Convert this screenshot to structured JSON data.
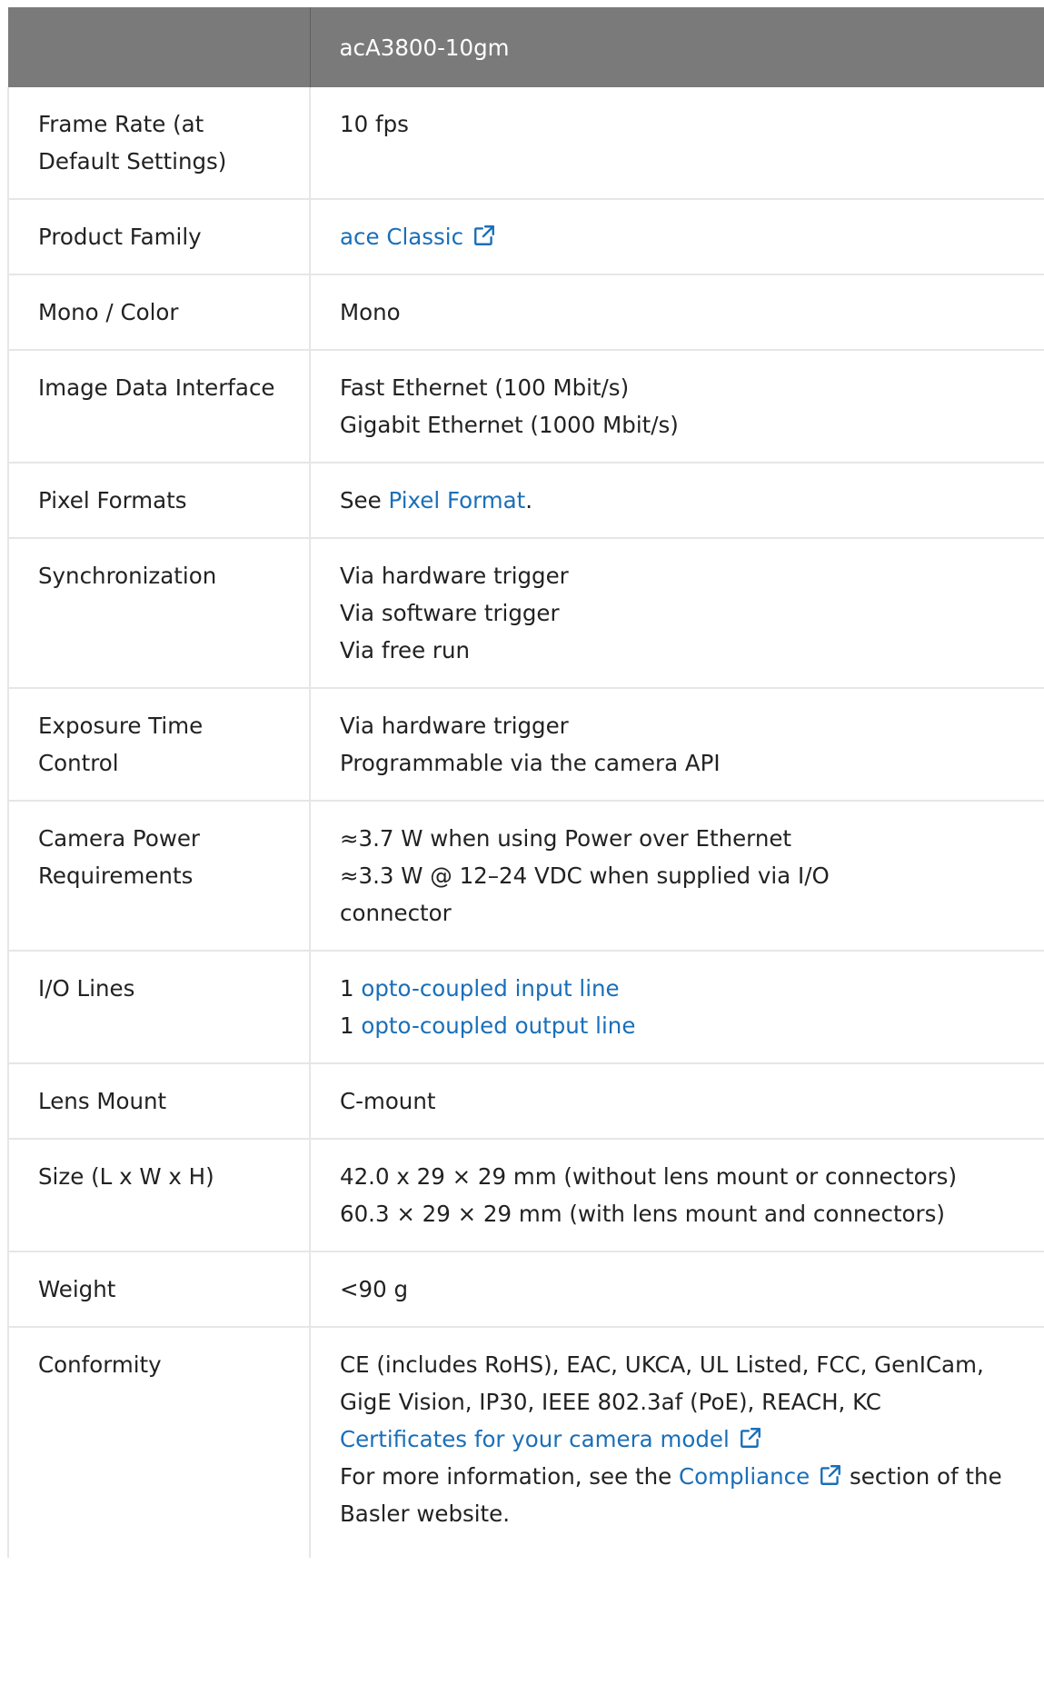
{
  "header": {
    "label_col": "",
    "model": "acA3800-10gm"
  },
  "rows": {
    "frame_rate": {
      "label": "Frame Rate (at Default Settings)",
      "value": "10 fps"
    },
    "product_family": {
      "label": "Product Family",
      "link": "ace Classic"
    },
    "mono_color": {
      "label": "Mono / Color",
      "value": "Mono"
    },
    "image_data_interface": {
      "label": "Image Data Interface",
      "lines": [
        "Fast Ethernet (100 Mbit/s)",
        "Gigabit Ethernet (1000 Mbit/s)"
      ]
    },
    "pixel_formats": {
      "label": "Pixel Formats",
      "prefix": "See ",
      "link": "Pixel Format",
      "suffix": "."
    },
    "synchronization": {
      "label": "Synchronization",
      "lines": [
        "Via hardware trigger",
        "Via software trigger",
        "Via free run"
      ]
    },
    "exposure_time_control": {
      "label": "Exposure Time Control",
      "lines": [
        "Via hardware trigger",
        "Programmable via the camera API"
      ]
    },
    "camera_power": {
      "label": "Camera Power Requirements",
      "lines": [
        "≈3.7 W when using Power over Ethernet",
        "≈3.3 W @ 12–24 VDC when supplied via I/O connector"
      ]
    },
    "io_lines": {
      "label": "I/O Lines",
      "input_prefix": "1 ",
      "input_link": "opto-coupled input line",
      "output_prefix": "1 ",
      "output_link": "opto-coupled output line"
    },
    "lens_mount": {
      "label": "Lens Mount",
      "value": "C-mount"
    },
    "size": {
      "label": "Size (L x W x H)",
      "lines": [
        "42.0 x 29 × 29 mm (without lens mount or connectors)",
        "60.3 × 29 × 29 mm (with lens mount and connectors)"
      ]
    },
    "weight": {
      "label": "Weight",
      "value": "<90 g"
    },
    "conformity": {
      "label": "Conformity",
      "text": "CE (includes RoHS), EAC, UKCA, UL Listed, FCC, GenICam, GigE Vision, IP30, IEEE 802.3af (PoE), REACH, KC",
      "certificates_link": "Certificates for your camera model",
      "more_prefix": "For more information, see the ",
      "compliance_link": "Compliance",
      "more_suffix": " section of the Basler website."
    }
  },
  "colors": {
    "header_bg": "#7a7a7a",
    "header_text": "#ffffff",
    "link": "#1a6fb8",
    "border": "#e6e6e6"
  },
  "icons": {
    "external_link": "external-link-icon"
  }
}
